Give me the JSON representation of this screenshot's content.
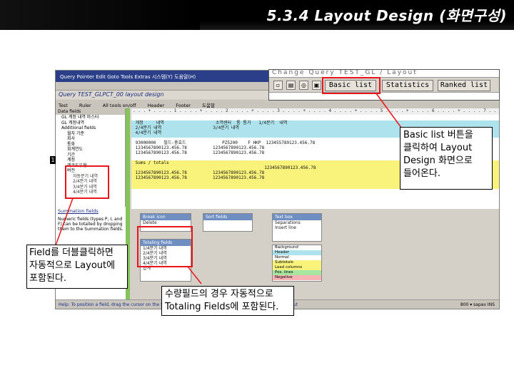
{
  "slide": {
    "title": "5.3.4 Layout Design (화면구성)"
  },
  "sap": {
    "menu": "Query  Pointer  Edit  Goto  Tools  Extras  시스템(Y)  도움말(H)",
    "query_title": "Query TEST_GLPCT_00 layout design",
    "toolbar_items": [
      "Test",
      "Ruler",
      "All tools on/off",
      "Header",
      "Footer",
      "도움말"
    ],
    "left_header": "Data fields",
    "tree": [
      {
        "label": "GL 계정 내역 마스터",
        "level": 0
      },
      {
        "label": "GL 계정내역",
        "level": 0
      },
      {
        "label": "Additional fields",
        "level": 0
      },
      {
        "label": "월차 기준",
        "level": 1
      },
      {
        "label": "회사",
        "level": 1
      },
      {
        "label": "통화",
        "level": 1
      },
      {
        "label": "회계연도",
        "level": 1
      },
      {
        "label": "기간",
        "level": 1
      },
      {
        "label": "계정",
        "level": 1
      },
      {
        "label": "레코드유형",
        "level": 1
      },
      {
        "label": "버전",
        "level": 1
      },
      {
        "label": "자동분기 내역",
        "level": 2
      },
      {
        "label": "2/4분기 내역",
        "level": 2
      },
      {
        "label": "3/4분기 내역",
        "level": 2
      },
      {
        "label": "4/4분기 내역",
        "level": 2
      }
    ],
    "summation_header": "Summation fields",
    "summation_text": "Numeric fields (types P, I, and F) can be totalled by dropping them to the Summation fields.",
    "ruler_text": ". . . + . . . . 1 . . . . + . . . . 2 . . . . + . . . . 3 . . . . + . . . . 4 . . . . + . . . . 5 . . . . + . . . . 6 . . . . + . . . . 7 . . . . + . . . . 8",
    "canvas_bands": [
      {
        "style": "cyan",
        "text": " 개정     내역                    소역센터  통 통가   1/4분기  내역\n 2/4분기 내역                    3/4분기 내역\n 4/4분기 내역"
      },
      {
        "style": "white",
        "text": " 93000000   필드-충효드              PZ5200    F HKP  123455789123.456.78\n 1234567890123.456.78          1234567890123.456.78\n 1234567890123.456.78          1234567890123.456.78"
      },
      {
        "style": "yellow",
        "text": " Sums / totals\n                                                   1234567890123.456.78\n 1234567890123.456.78          1234567890123.456.78\n 1234567890123.456.78          1234567890123.456.78"
      }
    ],
    "sort_box": {
      "header": "Break icon",
      "rows": [
        "Delete"
      ]
    },
    "sort_fields": {
      "header": "Sort fields",
      "rows": []
    },
    "totaling_box": {
      "header": "Totaling fields",
      "rows": [
        "1/4분기 내역",
        "2/4분기 내역",
        "3/4분기 내역",
        "4/4분기 내역",
        "합계"
      ]
    },
    "text_box": {
      "header": "Text box",
      "rows": [
        "Separations",
        "Insert line"
      ]
    },
    "legend": [
      {
        "label": "Background",
        "color": "#ffffff"
      },
      {
        "label": "Header",
        "color": "#aee2ec"
      },
      {
        "label": "Normal",
        "color": "#ffffff"
      },
      {
        "label": "Subtotals",
        "color": "#f9f27b"
      },
      {
        "label": "Lead columns",
        "color": "#f9f27b"
      },
      {
        "label": "Pos. lines",
        "color": "#a6e6a0"
      },
      {
        "label": "Negative",
        "color": "#f7b3b3"
      }
    ],
    "status_text": "Help: To position a field, drag the cursor on the field. To move, position and drag it. Totaling and sorting. Output",
    "status_right": "800 ▾ sapav INS"
  },
  "inset": {
    "top_text": "Change Query TEST_GL / Layout",
    "buttons": [
      "Basic list",
      "Statistics",
      "Ranked list"
    ]
  },
  "callouts": {
    "basic": [
      "Basic list 버튼을",
      "클릭하여 Layout",
      "Design 화면으로",
      "들어온다."
    ],
    "field": [
      "Field를 더블클릭하면",
      "자동적으로 Layout에",
      "포함된다."
    ],
    "totaling": [
      "수량필드의 경우 자동적으로",
      "Totaling Fields에 포함된다."
    ]
  },
  "marker": "1"
}
